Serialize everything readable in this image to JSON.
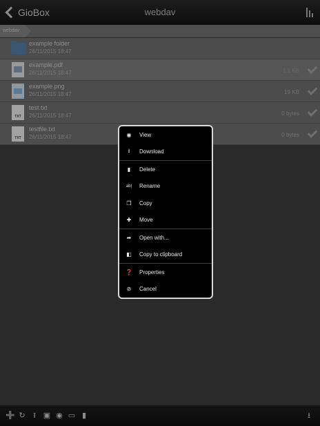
{
  "topbar": {
    "back_label": "GioBox",
    "title": "webdav"
  },
  "breadcrumb": {
    "label": "webdav"
  },
  "files": [
    {
      "name": "example folder",
      "date": "26/11/2015 18:47",
      "size": "",
      "type": "folder"
    },
    {
      "name": "example.pdf",
      "date": "26/11/2015 18:47",
      "size": "1.1 KB",
      "type": "pdf"
    },
    {
      "name": "example.png",
      "date": "26/11/2015 18:47",
      "size": "19 KB",
      "type": "png"
    },
    {
      "name": "test.txt",
      "date": "26/11/2015 18:47",
      "size": "0 bytes",
      "type": "txt"
    },
    {
      "name": "testfile.txt",
      "date": "26/11/2015 18:47",
      "size": "0 bytes",
      "type": "txt"
    }
  ],
  "txt_tag": "TXT",
  "menu": {
    "items": [
      {
        "label": "View",
        "icon": "eye-icon"
      },
      {
        "label": "Download",
        "icon": "download-icon"
      },
      {
        "label": "Delete",
        "icon": "trash-icon"
      },
      {
        "label": "Rename",
        "icon": "rename-icon"
      },
      {
        "label": "Copy",
        "icon": "copy-icon"
      },
      {
        "label": "Move",
        "icon": "move-icon"
      },
      {
        "label": "Open with...",
        "icon": "share-arrow-icon"
      },
      {
        "label": "Copy to clipboard",
        "icon": "clipboard-icon"
      },
      {
        "label": "Properties",
        "icon": "question-icon"
      },
      {
        "label": "Cancel",
        "icon": "cancel-icon"
      }
    ]
  },
  "toolbar_icons": [
    "add-icon",
    "refresh-icon",
    "upload-icon",
    "image-icon",
    "camera-icon",
    "screen-icon",
    "bookmark-icon",
    "download-icon"
  ]
}
